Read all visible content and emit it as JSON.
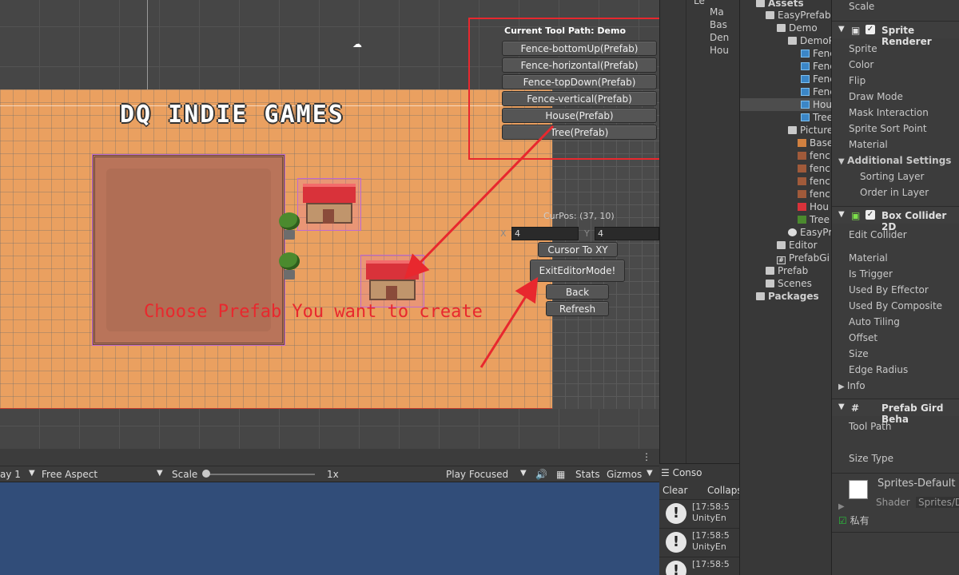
{
  "scene": {
    "logo_text": "DQ INDIE GAMES",
    "create_label": "Choose Prefab You want to create",
    "tool_path": "Current Tool Path: Demo",
    "prefab_buttons": [
      "Fence-bottomUp(Prefab)",
      "Fence-horizontal(Prefab)",
      "Fence-topDown(Prefab)",
      "Fence-vertical(Prefab)",
      "House(Prefab)",
      "Tree(Prefab)"
    ],
    "cur_pos": "CurPos: (37, 10)",
    "x_label": "X",
    "x_value": "4",
    "y_label": "Y",
    "y_value": "4",
    "cursor_button": "Cursor To XY",
    "exit_button": "ExitEditorMode!",
    "back_button": "Back",
    "refresh_button": "Refresh",
    "arrow_color": "#e8282e"
  },
  "game_toolbar": {
    "display": "ay 1",
    "aspect": "Free Aspect",
    "scale_label": "Scale",
    "scale_value": "1x",
    "play_mode": "Play Focused",
    "stats": "Stats",
    "gizmos": "Gizmos"
  },
  "hierarchy": {
    "items": [
      "Le",
      "Ma",
      "Bas",
      "Den",
      "Hou"
    ]
  },
  "project": {
    "items": [
      "Assets",
      "EasyPrefab",
      "Demo",
      "DemoP",
      "Fenc",
      "Fenc",
      "Fenc",
      "Fenc",
      "Hou",
      "Tree",
      "Picture",
      "Base",
      "fenc",
      "fenc",
      "fenc",
      "fenc",
      "Hou",
      "Tree",
      "EasyPr",
      "Editor",
      "PrefabGi",
      "Prefab",
      "Scenes",
      "Packages"
    ]
  },
  "console": {
    "tab": "Conso",
    "clear": "Clear",
    "collapse": "Collaps",
    "messages": [
      {
        "time": "[17:58:5",
        "src": "UnityEn"
      },
      {
        "time": "[17:58:5",
        "src": "UnityEn"
      },
      {
        "time": "[17:58:5",
        "src": ""
      }
    ]
  },
  "inspector": {
    "top": "Scale",
    "sprite_renderer": "Sprite Renderer",
    "sr_props": [
      "Sprite",
      "Color",
      "Flip",
      "Draw Mode",
      "Mask Interaction",
      "Sprite Sort Point",
      "Material"
    ],
    "additional": "Additional Settings",
    "add_props": [
      "Sorting Layer",
      "Order in Layer"
    ],
    "box_collider": "Box Collider 2D",
    "edit_collider": "Edit Collider",
    "bc_props": [
      "Material",
      "Is Trigger",
      "Used By Effector",
      "Used By Composite",
      "Auto Tiling",
      "Offset",
      "Size",
      "Edge Radius",
      "Info"
    ],
    "prefab_grid": "Prefab Gird Beha",
    "tool_path": "Tool Path",
    "size_type": "Size Type",
    "material_name": "Sprites-Default (",
    "shader_label": "Shader",
    "shader_value": "Sprites/D",
    "private": "私有"
  }
}
